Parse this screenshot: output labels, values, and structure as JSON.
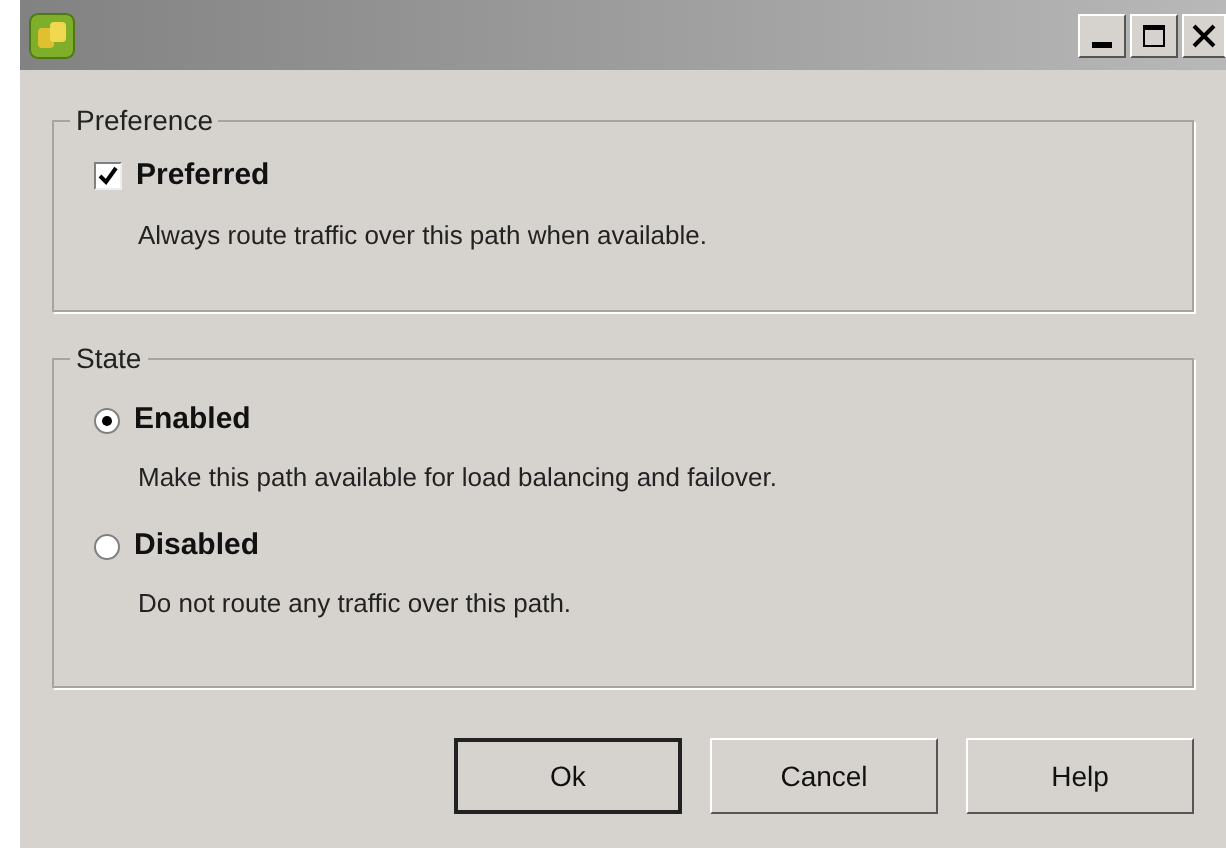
{
  "preference": {
    "title": "Preference",
    "checkbox": {
      "label": "Preferred",
      "checked": true,
      "description": "Always route traffic over this path when available."
    }
  },
  "state": {
    "title": "State",
    "options": [
      {
        "label": "Enabled",
        "selected": true,
        "description": "Make this path available for load balancing and failover."
      },
      {
        "label": "Disabled",
        "selected": false,
        "description": "Do not route any traffic over this path."
      }
    ]
  },
  "buttons": [
    {
      "label": "Ok",
      "default": true
    },
    {
      "label": "Cancel",
      "default": false
    },
    {
      "label": "Help",
      "default": false
    }
  ]
}
